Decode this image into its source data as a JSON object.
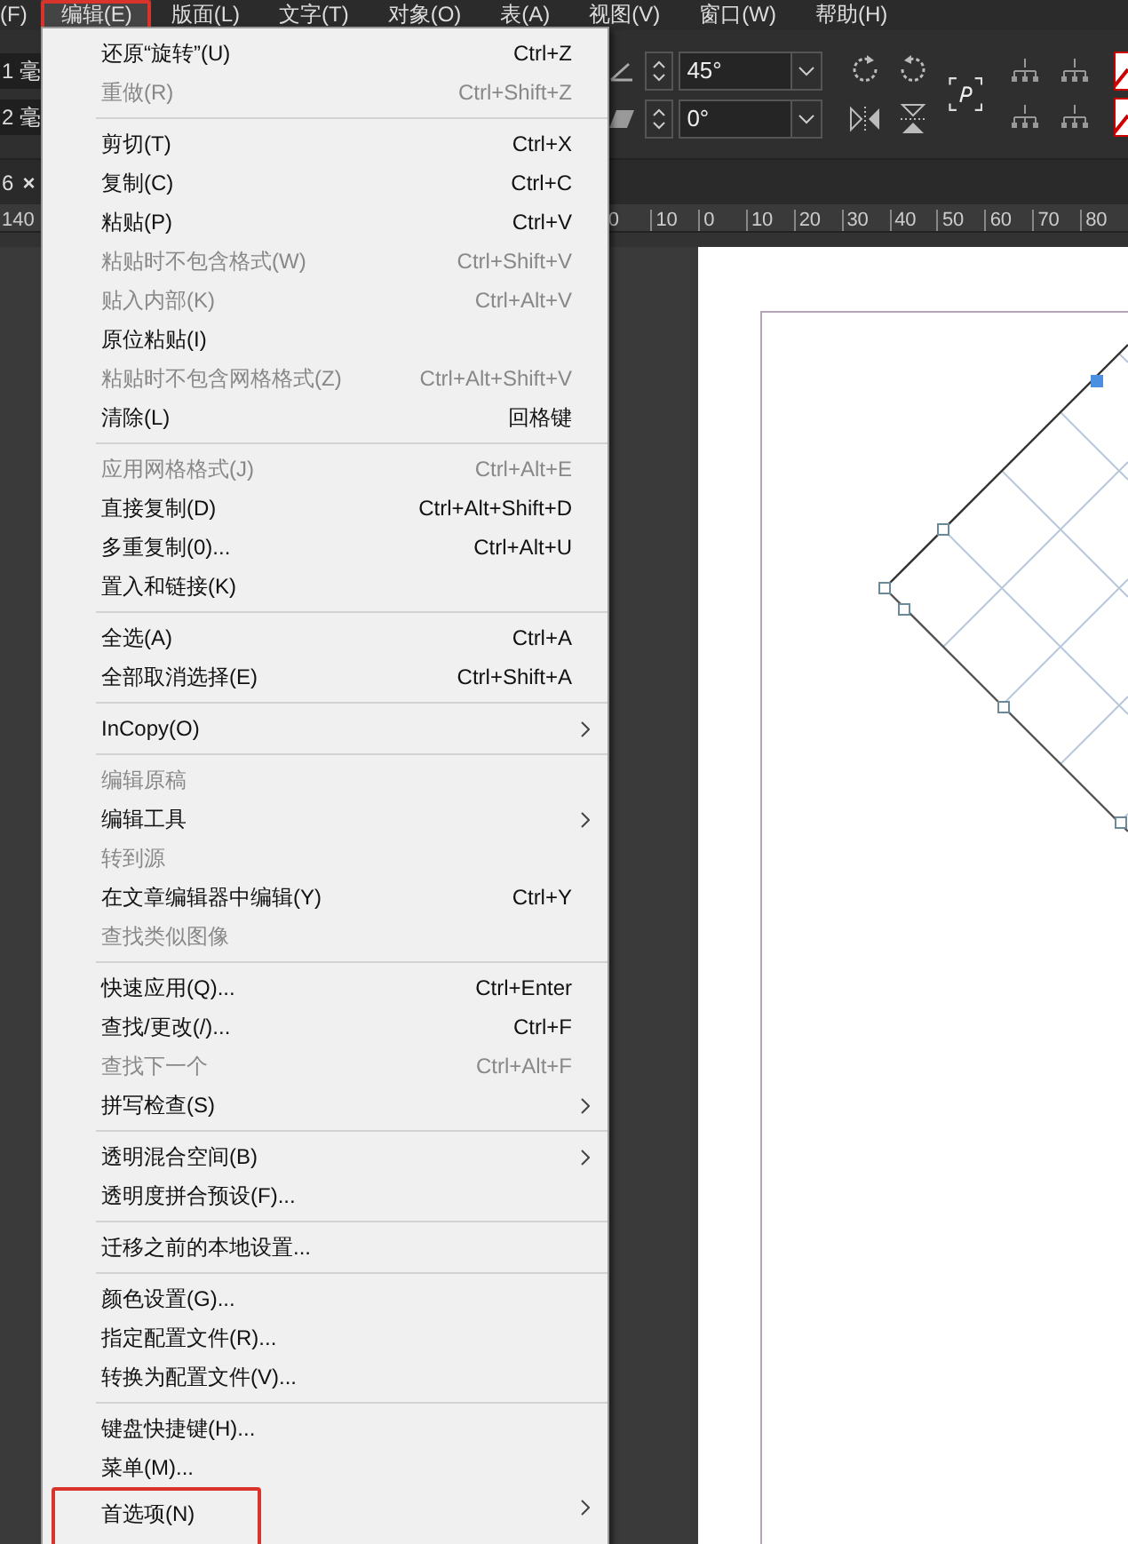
{
  "menubar": [
    {
      "label": "(F)",
      "selected": false,
      "annotated": false
    },
    {
      "label": "编辑(E)",
      "selected": true,
      "annotated": true
    },
    {
      "label": "版面(L)",
      "selected": false,
      "annotated": false
    },
    {
      "label": "文字(T)",
      "selected": false,
      "annotated": false
    },
    {
      "label": "对象(O)",
      "selected": false,
      "annotated": false
    },
    {
      "label": "表(A)",
      "selected": false,
      "annotated": false
    },
    {
      "label": "视图(V)",
      "selected": false,
      "annotated": false
    },
    {
      "label": "窗口(W)",
      "selected": false,
      "annotated": false
    },
    {
      "label": "帮助(H)",
      "selected": false,
      "annotated": false
    }
  ],
  "toolbar": {
    "left_fields": [
      "1 毫",
      "2 毫"
    ],
    "angle_field": {
      "value": "45°"
    },
    "shear_field": {
      "value": "0°"
    }
  },
  "document_tab": {
    "label": "6",
    "close": "×"
  },
  "ruler": {
    "left_label": "140",
    "labels": [
      "0",
      "10",
      "0",
      "10",
      "20",
      "30",
      "40",
      "50",
      "60",
      "70",
      "80"
    ]
  },
  "menu": {
    "sections": [
      [
        {
          "label": "还原“旋转”(U)",
          "shortcut": "Ctrl+Z",
          "disabled": false,
          "submenu": false,
          "annotated": false
        },
        {
          "label": "重做(R)",
          "shortcut": "Ctrl+Shift+Z",
          "disabled": true,
          "submenu": false,
          "annotated": false
        }
      ],
      [
        {
          "label": "剪切(T)",
          "shortcut": "Ctrl+X",
          "disabled": false,
          "submenu": false,
          "annotated": false
        },
        {
          "label": "复制(C)",
          "shortcut": "Ctrl+C",
          "disabled": false,
          "submenu": false,
          "annotated": false
        },
        {
          "label": "粘贴(P)",
          "shortcut": "Ctrl+V",
          "disabled": false,
          "submenu": false,
          "annotated": false
        },
        {
          "label": "粘贴时不包含格式(W)",
          "shortcut": "Ctrl+Shift+V",
          "disabled": true,
          "submenu": false,
          "annotated": false
        },
        {
          "label": "贴入内部(K)",
          "shortcut": "Ctrl+Alt+V",
          "disabled": true,
          "submenu": false,
          "annotated": false
        },
        {
          "label": "原位粘贴(I)",
          "disabled": false,
          "submenu": false,
          "annotated": false
        },
        {
          "label": "粘贴时不包含网格格式(Z)",
          "shortcut": "Ctrl+Alt+Shift+V",
          "disabled": true,
          "submenu": false,
          "annotated": false
        },
        {
          "label": "清除(L)",
          "shortcut": "回格键",
          "disabled": false,
          "submenu": false,
          "annotated": false
        }
      ],
      [
        {
          "label": "应用网格格式(J)",
          "shortcut": "Ctrl+Alt+E",
          "disabled": true,
          "submenu": false,
          "annotated": false
        },
        {
          "label": "直接复制(D)",
          "shortcut": "Ctrl+Alt+Shift+D",
          "disabled": false,
          "submenu": false,
          "annotated": false
        },
        {
          "label": "多重复制(0)...",
          "shortcut": "Ctrl+Alt+U",
          "disabled": false,
          "submenu": false,
          "annotated": false
        },
        {
          "label": "置入和链接(K)",
          "disabled": false,
          "submenu": false,
          "annotated": false
        }
      ],
      [
        {
          "label": "全选(A)",
          "shortcut": "Ctrl+A",
          "disabled": false,
          "submenu": false,
          "annotated": false
        },
        {
          "label": "全部取消选择(E)",
          "shortcut": "Ctrl+Shift+A",
          "disabled": false,
          "submenu": false,
          "annotated": false
        }
      ],
      [
        {
          "label": "InCopy(O)",
          "disabled": false,
          "submenu": true,
          "annotated": false
        }
      ],
      [
        {
          "label": "编辑原稿",
          "disabled": true,
          "submenu": false,
          "annotated": false
        },
        {
          "label": "编辑工具",
          "disabled": false,
          "submenu": true,
          "annotated": false
        },
        {
          "label": "转到源",
          "disabled": true,
          "submenu": false,
          "annotated": false
        },
        {
          "label": "在文章编辑器中编辑(Y)",
          "shortcut": "Ctrl+Y",
          "disabled": false,
          "submenu": false,
          "annotated": false
        },
        {
          "label": "查找类似图像",
          "disabled": true,
          "submenu": false,
          "annotated": false
        }
      ],
      [
        {
          "label": "快速应用(Q)...",
          "shortcut": "Ctrl+Enter",
          "disabled": false,
          "submenu": false,
          "annotated": false
        },
        {
          "label": "查找/更改(/)...",
          "shortcut": "Ctrl+F",
          "disabled": false,
          "submenu": false,
          "annotated": false
        },
        {
          "label": "查找下一个",
          "shortcut": "Ctrl+Alt+F",
          "disabled": true,
          "submenu": false,
          "annotated": false
        },
        {
          "label": "拼写检查(S)",
          "disabled": false,
          "submenu": true,
          "annotated": false
        }
      ],
      [
        {
          "label": "透明混合空间(B)",
          "disabled": false,
          "submenu": true,
          "annotated": false
        },
        {
          "label": "透明度拼合预设(F)...",
          "disabled": false,
          "submenu": false,
          "annotated": false
        }
      ],
      [
        {
          "label": "迁移之前的本地设置...",
          "disabled": false,
          "submenu": false,
          "annotated": false
        }
      ],
      [
        {
          "label": "颜色设置(G)...",
          "disabled": false,
          "submenu": false,
          "annotated": false
        },
        {
          "label": "指定配置文件(R)...",
          "disabled": false,
          "submenu": false,
          "annotated": false
        },
        {
          "label": "转换为配置文件(V)...",
          "disabled": false,
          "submenu": false,
          "annotated": false
        }
      ],
      [
        {
          "label": "键盘快捷键(H)...",
          "disabled": false,
          "submenu": false,
          "annotated": false
        },
        {
          "label": "菜单(M)...",
          "disabled": false,
          "submenu": false,
          "annotated": false
        },
        {
          "label": "首选项(N)",
          "disabled": false,
          "submenu": true,
          "annotated": true
        }
      ]
    ]
  }
}
